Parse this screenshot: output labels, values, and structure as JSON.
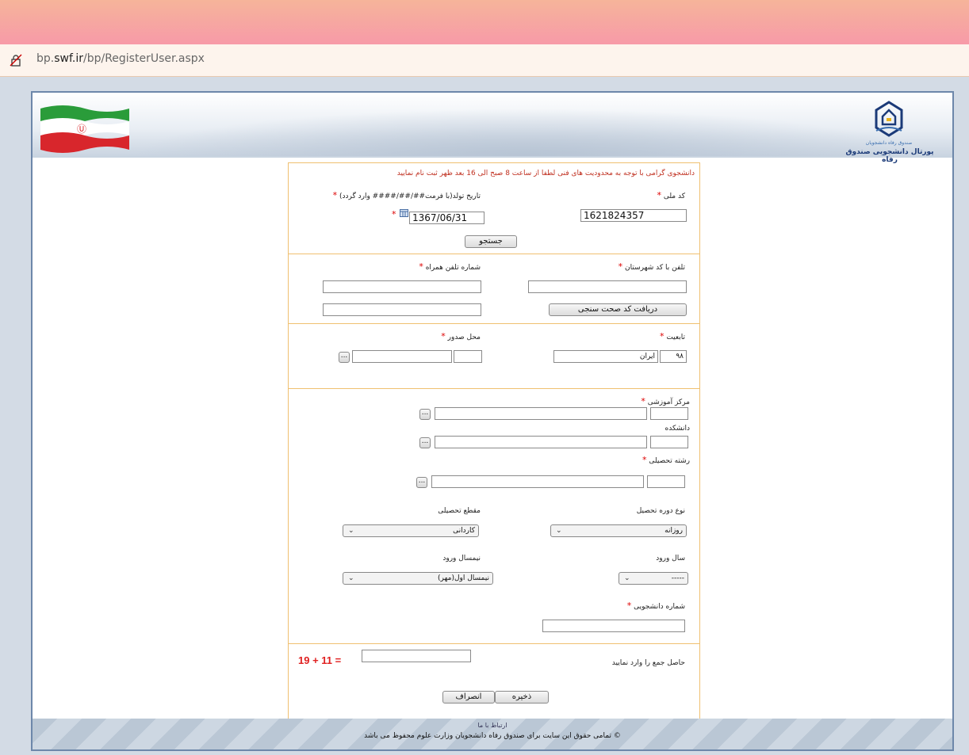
{
  "browser": {
    "url_prefix": "bp.",
    "url_domain": "swf.ir",
    "url_path": "/bp/RegisterUser.aspx"
  },
  "header": {
    "logo_line1": "صندوق رفاه دانشجویان",
    "logo_line2": "پورتال دانشجویی صندوق رفاه"
  },
  "notice": "دانشجوی گرامی با توجه به محدودیت های فنی لطفا از ساعت 8 صبح الی 16 بعد ظهر ثبت نام نمایید",
  "section1": {
    "national_code_label": "کد ملی",
    "birth_date_label": "تاریخ تولد(با فرمت##/##/#### وارد گردد)",
    "national_code_value": "1621824357",
    "birth_date_value": "1367/06/31",
    "search_button": "جستجو"
  },
  "section2": {
    "phone_label": "تلفن با کد شهرستان",
    "mobile_label": "شماره تلفن همراه",
    "verify_button": "دریافت کد صحت سنجی"
  },
  "section3": {
    "nationality_label": "تابعیت",
    "issue_place_label": "محل صدور",
    "nationality_code": "۹۸",
    "nationality_name": "ایران",
    "lookup_button": "..."
  },
  "section4": {
    "edu_center_label": "مرکز آموزشی",
    "faculty_label": "دانشکده",
    "major_label": "رشته تحصیلی",
    "course_type_label": "نوع دوره تحصیل",
    "degree_label": "مقطع تحصیلی",
    "course_type_value": "روزانه",
    "degree_value": "کاردانی",
    "entry_year_label": "سال ورود",
    "entry_semester_label": "نیمسال ورود",
    "entry_year_value": "-----",
    "entry_semester_value": "نیمسال اول(مهر)",
    "student_no_label": "شماره دانشجویی",
    "lookup_button": "..."
  },
  "section5": {
    "captcha_prompt": "حاصل جمع را وارد نمایید",
    "captcha_text": "19 + 11 =",
    "save_button": "ذخیره",
    "cancel_button": "انصراف"
  },
  "footer": {
    "contact_link": "ارتباط با ما",
    "copyright": "© تمامی حقوق این سایت برای صندوق رفاه دانشجویان وزارت علوم محفوظ می باشد"
  },
  "colors": {
    "required": "#dd0000",
    "notice": "#c03020",
    "section_border": "#f0c070",
    "frame_border": "#6d87aa"
  }
}
